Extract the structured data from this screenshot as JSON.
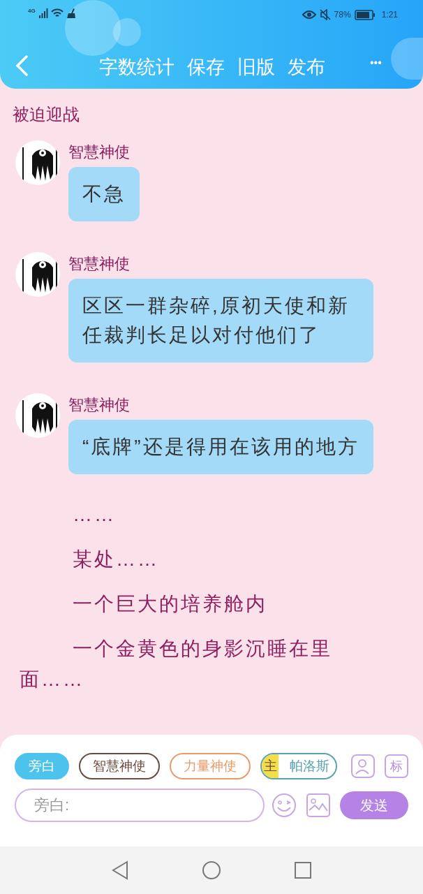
{
  "status_bar": {
    "network": "4G",
    "battery": "78%",
    "time": "1:21"
  },
  "toolbar": {
    "actions": [
      "字数统计",
      "保存",
      "旧版",
      "发布"
    ],
    "more": "•••"
  },
  "chapter_title": "被迫迎战",
  "messages": [
    {
      "kind": "message",
      "speaker": "智慧神使",
      "text": "不急"
    },
    {
      "kind": "message",
      "speaker": "智慧神使",
      "text": "区区一群杂碎,原初天使和新任裁判长足以对付他们了"
    },
    {
      "kind": "message",
      "speaker": "智慧神使",
      "text": "“底牌”还是得用在该用的地方"
    },
    {
      "kind": "narration",
      "text": "……"
    },
    {
      "kind": "narration",
      "text": "某处……"
    },
    {
      "kind": "narration",
      "text": "一个巨大的培养舱内"
    },
    {
      "kind": "narration",
      "text": "一个金黄色的身影沉睡在里面……"
    }
  ],
  "composer": {
    "characters": [
      {
        "name": "旁白",
        "selected": true,
        "color": "#4cc3ec"
      },
      {
        "name": "智慧神使",
        "selected": false,
        "color": "#6b4a3f"
      },
      {
        "name": "力量神使",
        "selected": false,
        "color": "#ec9a6a"
      },
      {
        "name": "帕洛斯",
        "selected": false,
        "color": "#5aa3b0",
        "badge": "主"
      }
    ],
    "tag_button": "标",
    "input": {
      "placeholder": "旁白:"
    },
    "send": "发送"
  }
}
